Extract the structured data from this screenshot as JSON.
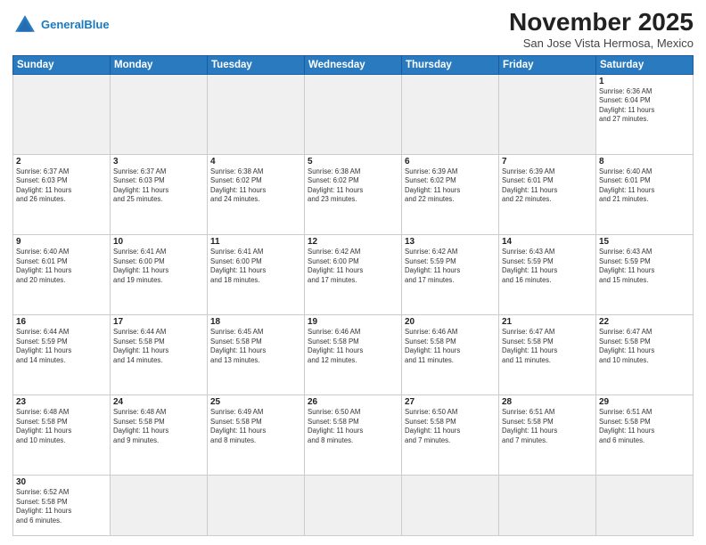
{
  "header": {
    "logo_general": "General",
    "logo_blue": "Blue",
    "month_title": "November 2025",
    "location": "San Jose Vista Hermosa, Mexico"
  },
  "days_of_week": [
    "Sunday",
    "Monday",
    "Tuesday",
    "Wednesday",
    "Thursday",
    "Friday",
    "Saturday"
  ],
  "weeks": [
    [
      {
        "day": "",
        "info": ""
      },
      {
        "day": "",
        "info": ""
      },
      {
        "day": "",
        "info": ""
      },
      {
        "day": "",
        "info": ""
      },
      {
        "day": "",
        "info": ""
      },
      {
        "day": "",
        "info": ""
      },
      {
        "day": "1",
        "info": "Sunrise: 6:36 AM\nSunset: 6:04 PM\nDaylight: 11 hours\nand 27 minutes."
      }
    ],
    [
      {
        "day": "2",
        "info": "Sunrise: 6:37 AM\nSunset: 6:03 PM\nDaylight: 11 hours\nand 26 minutes."
      },
      {
        "day": "3",
        "info": "Sunrise: 6:37 AM\nSunset: 6:03 PM\nDaylight: 11 hours\nand 25 minutes."
      },
      {
        "day": "4",
        "info": "Sunrise: 6:38 AM\nSunset: 6:02 PM\nDaylight: 11 hours\nand 24 minutes."
      },
      {
        "day": "5",
        "info": "Sunrise: 6:38 AM\nSunset: 6:02 PM\nDaylight: 11 hours\nand 23 minutes."
      },
      {
        "day": "6",
        "info": "Sunrise: 6:39 AM\nSunset: 6:02 PM\nDaylight: 11 hours\nand 22 minutes."
      },
      {
        "day": "7",
        "info": "Sunrise: 6:39 AM\nSunset: 6:01 PM\nDaylight: 11 hours\nand 22 minutes."
      },
      {
        "day": "8",
        "info": "Sunrise: 6:40 AM\nSunset: 6:01 PM\nDaylight: 11 hours\nand 21 minutes."
      }
    ],
    [
      {
        "day": "9",
        "info": "Sunrise: 6:40 AM\nSunset: 6:01 PM\nDaylight: 11 hours\nand 20 minutes."
      },
      {
        "day": "10",
        "info": "Sunrise: 6:41 AM\nSunset: 6:00 PM\nDaylight: 11 hours\nand 19 minutes."
      },
      {
        "day": "11",
        "info": "Sunrise: 6:41 AM\nSunset: 6:00 PM\nDaylight: 11 hours\nand 18 minutes."
      },
      {
        "day": "12",
        "info": "Sunrise: 6:42 AM\nSunset: 6:00 PM\nDaylight: 11 hours\nand 17 minutes."
      },
      {
        "day": "13",
        "info": "Sunrise: 6:42 AM\nSunset: 5:59 PM\nDaylight: 11 hours\nand 17 minutes."
      },
      {
        "day": "14",
        "info": "Sunrise: 6:43 AM\nSunset: 5:59 PM\nDaylight: 11 hours\nand 16 minutes."
      },
      {
        "day": "15",
        "info": "Sunrise: 6:43 AM\nSunset: 5:59 PM\nDaylight: 11 hours\nand 15 minutes."
      }
    ],
    [
      {
        "day": "16",
        "info": "Sunrise: 6:44 AM\nSunset: 5:59 PM\nDaylight: 11 hours\nand 14 minutes."
      },
      {
        "day": "17",
        "info": "Sunrise: 6:44 AM\nSunset: 5:58 PM\nDaylight: 11 hours\nand 14 minutes."
      },
      {
        "day": "18",
        "info": "Sunrise: 6:45 AM\nSunset: 5:58 PM\nDaylight: 11 hours\nand 13 minutes."
      },
      {
        "day": "19",
        "info": "Sunrise: 6:46 AM\nSunset: 5:58 PM\nDaylight: 11 hours\nand 12 minutes."
      },
      {
        "day": "20",
        "info": "Sunrise: 6:46 AM\nSunset: 5:58 PM\nDaylight: 11 hours\nand 11 minutes."
      },
      {
        "day": "21",
        "info": "Sunrise: 6:47 AM\nSunset: 5:58 PM\nDaylight: 11 hours\nand 11 minutes."
      },
      {
        "day": "22",
        "info": "Sunrise: 6:47 AM\nSunset: 5:58 PM\nDaylight: 11 hours\nand 10 minutes."
      }
    ],
    [
      {
        "day": "23",
        "info": "Sunrise: 6:48 AM\nSunset: 5:58 PM\nDaylight: 11 hours\nand 10 minutes."
      },
      {
        "day": "24",
        "info": "Sunrise: 6:48 AM\nSunset: 5:58 PM\nDaylight: 11 hours\nand 9 minutes."
      },
      {
        "day": "25",
        "info": "Sunrise: 6:49 AM\nSunset: 5:58 PM\nDaylight: 11 hours\nand 8 minutes."
      },
      {
        "day": "26",
        "info": "Sunrise: 6:50 AM\nSunset: 5:58 PM\nDaylight: 11 hours\nand 8 minutes."
      },
      {
        "day": "27",
        "info": "Sunrise: 6:50 AM\nSunset: 5:58 PM\nDaylight: 11 hours\nand 7 minutes."
      },
      {
        "day": "28",
        "info": "Sunrise: 6:51 AM\nSunset: 5:58 PM\nDaylight: 11 hours\nand 7 minutes."
      },
      {
        "day": "29",
        "info": "Sunrise: 6:51 AM\nSunset: 5:58 PM\nDaylight: 11 hours\nand 6 minutes."
      }
    ],
    [
      {
        "day": "30",
        "info": "Sunrise: 6:52 AM\nSunset: 5:58 PM\nDaylight: 11 hours\nand 6 minutes."
      },
      {
        "day": "",
        "info": ""
      },
      {
        "day": "",
        "info": ""
      },
      {
        "day": "",
        "info": ""
      },
      {
        "day": "",
        "info": ""
      },
      {
        "day": "",
        "info": ""
      },
      {
        "day": "",
        "info": ""
      }
    ]
  ]
}
